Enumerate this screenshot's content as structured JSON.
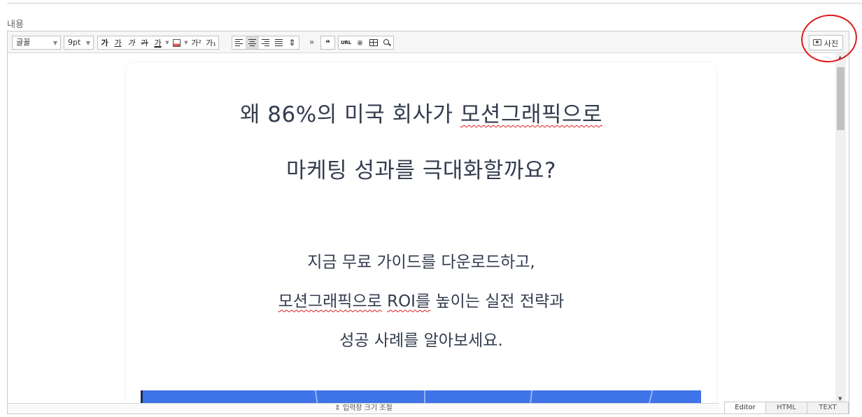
{
  "field_label": "내용",
  "toolbar": {
    "font_select": "글꼴",
    "size_select": "9pt",
    "text_style_buttons": [
      "가",
      "가",
      "가",
      "가",
      "가"
    ],
    "superscript": "가²",
    "subscript": "가₁",
    "more": "»",
    "quote": "❝",
    "url": "URL",
    "special_char": "※",
    "photo_label": "사진"
  },
  "content": {
    "headline_line1_a": "왜 86%의 미국 회사가 ",
    "headline_line1_b": "모션그래픽으로",
    "headline_line2": "마케팅 성과를 극대화할까요?",
    "body_line1": "지금 무료 가이드를 다운로드하고,",
    "body_line2_a": "모션그래픽으로",
    "body_line2_b": " ",
    "body_line2_c": "ROI를",
    "body_line2_d": " 높이는 실전 전략과",
    "body_line3": "성공 사례를 알아보세요."
  },
  "footer": {
    "resize_label": "⇕ 입력창 크기 조절",
    "modes": [
      "Editor",
      "HTML",
      "TEXT"
    ],
    "active_mode": "Editor"
  },
  "colors": {
    "heading_text": "#333d4f",
    "spellcheck_underline": "#e02020",
    "annotation_circle": "#e21a1a",
    "banner": "#3f73e8"
  }
}
